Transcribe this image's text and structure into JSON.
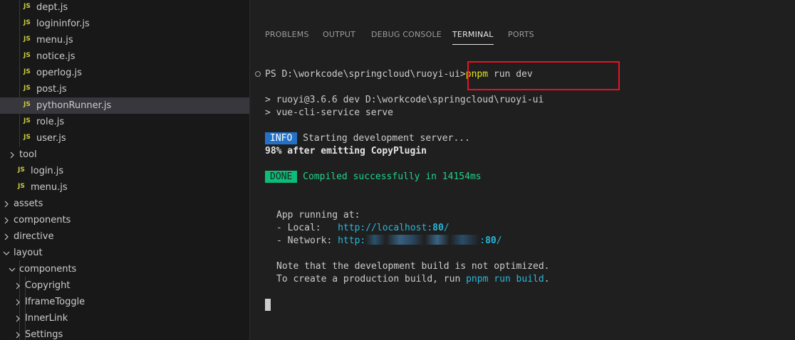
{
  "explorer": {
    "items": [
      {
        "label": "dept.js",
        "kind": "js"
      },
      {
        "label": "logininfor.js",
        "kind": "js"
      },
      {
        "label": "menu.js",
        "kind": "js"
      },
      {
        "label": "notice.js",
        "kind": "js"
      },
      {
        "label": "operlog.js",
        "kind": "js"
      },
      {
        "label": "post.js",
        "kind": "js"
      },
      {
        "label": "pythonRunner.js",
        "kind": "js",
        "selected": true
      },
      {
        "label": "role.js",
        "kind": "js"
      },
      {
        "label": "user.js",
        "kind": "js"
      },
      {
        "label": "tool",
        "kind": "folder",
        "expanded": false
      },
      {
        "label": "login.js",
        "kind": "js"
      },
      {
        "label": "menu.js",
        "kind": "js"
      },
      {
        "label": "assets",
        "kind": "folder",
        "expanded": false
      },
      {
        "label": "components",
        "kind": "folder",
        "expanded": false
      },
      {
        "label": "directive",
        "kind": "folder",
        "expanded": false
      },
      {
        "label": "layout",
        "kind": "folder",
        "expanded": true
      },
      {
        "label": "components",
        "kind": "folder",
        "expanded": true
      },
      {
        "label": "Copyright",
        "kind": "folder",
        "expanded": false
      },
      {
        "label": "IframeToggle",
        "kind": "folder",
        "expanded": false
      },
      {
        "label": "InnerLink",
        "kind": "folder",
        "expanded": false
      },
      {
        "label": "Settings",
        "kind": "folder",
        "expanded": false
      }
    ],
    "js_badge": "JS"
  },
  "panel": {
    "tabs": [
      {
        "label": "PROBLEMS"
      },
      {
        "label": "OUTPUT"
      },
      {
        "label": "DEBUG CONSOLE"
      },
      {
        "label": "TERMINAL",
        "active": true
      },
      {
        "label": "PORTS"
      }
    ]
  },
  "terminal": {
    "prompt": "PS D:\\workcode\\springcloud\\ruoyi-ui>",
    "command_name": "pnpm",
    "command_args": " run dev",
    "line_script1": "> ruoyi@3.6.6 dev D:\\workcode\\springcloud\\ruoyi-ui",
    "line_script2": "> vue-cli-service serve",
    "info_badge": "INFO",
    "info_text": " Starting development server...",
    "progress_line": "98% after emitting CopyPlugin",
    "done_badge": "DONE",
    "done_text": " Compiled successfully in 14154ms",
    "app_running": "App running at:",
    "local_label": "- Local:   ",
    "local_url_prefix": "http://localhost:",
    "local_port": "80",
    "local_url_suffix": "/",
    "network_label": "- Network: ",
    "network_url_prefix": "http:",
    "network_port_prefix": ":",
    "network_port": "80",
    "network_url_suffix": "/",
    "note_line": "Note that the development build is not optimized.",
    "prod_line_prefix": "To create a production build, run ",
    "prod_command": "pnpm run build",
    "prod_line_suffix": "."
  },
  "colors": {
    "highlight_box": "#e81123",
    "js_icon": "#cbcb41",
    "info_badge": "#2472c8",
    "done_badge": "#0dbc79",
    "link": "#29b8db"
  }
}
